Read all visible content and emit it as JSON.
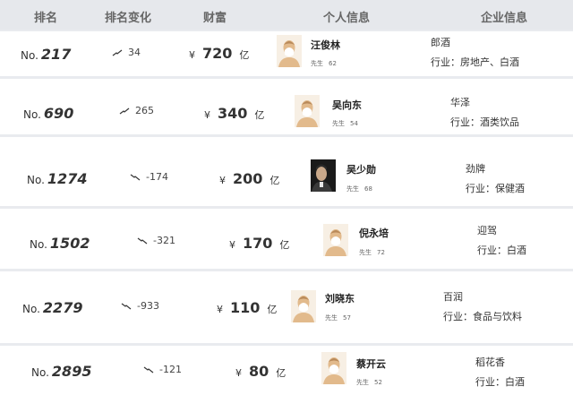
{
  "header": {
    "rank": "排名",
    "rank_change": "排名变化",
    "wealth": "财富",
    "personal_info": "个人信息",
    "company_info": "企业信息"
  },
  "rows": [
    {
      "rank_prefix": "No.",
      "rank": "217",
      "change": "34",
      "trend": "up",
      "currency": "¥",
      "wealth": "720",
      "unit": "亿",
      "name": "汪俊林",
      "gender": "先生",
      "age": "62",
      "company": "郎酒",
      "industry": "行业：房地产、白酒",
      "avatar": "silhouette"
    },
    {
      "rank_prefix": "No.",
      "rank": "690",
      "change": "265",
      "trend": "up",
      "currency": "¥",
      "wealth": "340",
      "unit": "亿",
      "name": "吴向东",
      "gender": "先生",
      "age": "54",
      "company": "华泽",
      "industry": "行业：酒类饮品",
      "avatar": "silhouette"
    },
    {
      "rank_prefix": "No.",
      "rank": "1274",
      "change": "-174",
      "trend": "down",
      "currency": "¥",
      "wealth": "200",
      "unit": "亿",
      "name": "吴少勋",
      "gender": "先生",
      "age": "68",
      "company": "劲牌",
      "industry": "行业：保健酒",
      "avatar": "photo"
    },
    {
      "rank_prefix": "No.",
      "rank": "1502",
      "change": "-321",
      "trend": "down",
      "currency": "¥",
      "wealth": "170",
      "unit": "亿",
      "name": "倪永培",
      "gender": "先生",
      "age": "72",
      "company": "迎驾",
      "industry": "行业：白酒",
      "avatar": "silhouette"
    },
    {
      "rank_prefix": "No.",
      "rank": "2279",
      "change": "-933",
      "trend": "down",
      "currency": "¥",
      "wealth": "110",
      "unit": "亿",
      "name": "刘晓东",
      "gender": "先生",
      "age": "57",
      "company": "百润",
      "industry": "行业：食品与饮料",
      "avatar": "silhouette"
    },
    {
      "rank_prefix": "No.",
      "rank": "2895",
      "change": "-121",
      "trend": "down",
      "currency": "¥",
      "wealth": "80",
      "unit": "亿",
      "name": "蔡开云",
      "gender": "先生",
      "age": "52",
      "company": "稻花香",
      "industry": "行业：白酒",
      "avatar": "silhouette"
    }
  ]
}
